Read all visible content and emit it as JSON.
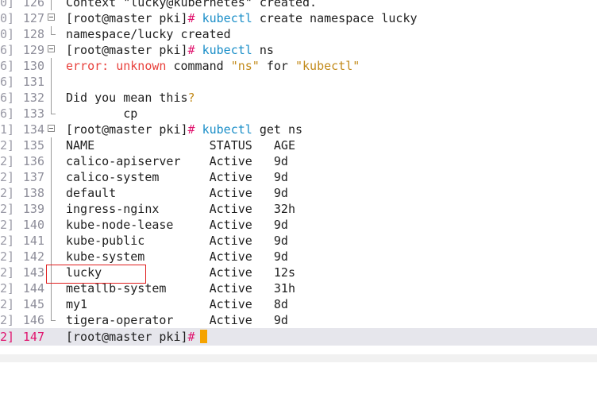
{
  "terminal": {
    "highlight_color": "#e02020",
    "prompt_color": "#e0146e",
    "command_color": "#1a8ec8",
    "error_color": "#e8413c",
    "string_color": "#c28a1a",
    "rows": {
      "r126": {
        "ts": "0]",
        "num": "126",
        "text": "Context \"lucky@kubernetes\" created."
      },
      "r127": {
        "ts": "0]",
        "num": "127",
        "prompt": "[root@master pki]",
        "hash": "#",
        "cmd": "kubectl",
        "args": " create namespace lucky"
      },
      "r128": {
        "ts": "0]",
        "num": "128",
        "text": "namespace/lucky created"
      },
      "r129": {
        "ts": "6]",
        "num": "129",
        "prompt": "[root@master pki]",
        "hash": "#",
        "cmd": "kubectl",
        "args": " ns"
      },
      "r130": {
        "ts": "6]",
        "num": "130",
        "err1": "error:",
        "err2": " unknown",
        "plain1": " command ",
        "str1": "\"ns\"",
        "plain2": " for ",
        "str2": "\"kubectl\""
      },
      "r131": {
        "ts": "6]",
        "num": "131",
        "text": ""
      },
      "r132": {
        "ts": "6]",
        "num": "132",
        "text": "Did you mean this",
        "q": "?"
      },
      "r133": {
        "ts": "6]",
        "num": "133",
        "text": "        cp"
      },
      "r134": {
        "ts": "1]",
        "num": "134",
        "prompt": "[root@master pki]",
        "hash": "#",
        "cmd": "kubectl",
        "args": " get ns"
      },
      "r135": {
        "ts": "2]",
        "num": "135",
        "text": "NAME                STATUS   AGE"
      },
      "r136": {
        "ts": "2]",
        "num": "136",
        "text": "calico-apiserver    Active   9d"
      },
      "r137": {
        "ts": "2]",
        "num": "137",
        "text": "calico-system       Active   9d"
      },
      "r138": {
        "ts": "2]",
        "num": "138",
        "text": "default             Active   9d"
      },
      "r139": {
        "ts": "2]",
        "num": "139",
        "text": "ingress-nginx       Active   32h"
      },
      "r140": {
        "ts": "2]",
        "num": "140",
        "text": "kube-node-lease     Active   9d"
      },
      "r141": {
        "ts": "2]",
        "num": "141",
        "text": "kube-public         Active   9d"
      },
      "r142": {
        "ts": "2]",
        "num": "142",
        "text": "kube-system         Active   9d"
      },
      "r143": {
        "ts": "2]",
        "num": "143",
        "text": "lucky               Active   12s"
      },
      "r144": {
        "ts": "2]",
        "num": "144",
        "text": "metallb-system      Active   31h"
      },
      "r145": {
        "ts": "2]",
        "num": "145",
        "text": "my1                 Active   8d"
      },
      "r146": {
        "ts": "2]",
        "num": "146",
        "text": "tigera-operator     Active   9d"
      },
      "r147": {
        "ts": "2]",
        "num": "147",
        "prompt": "[root@master pki]",
        "hash": "#"
      }
    }
  }
}
